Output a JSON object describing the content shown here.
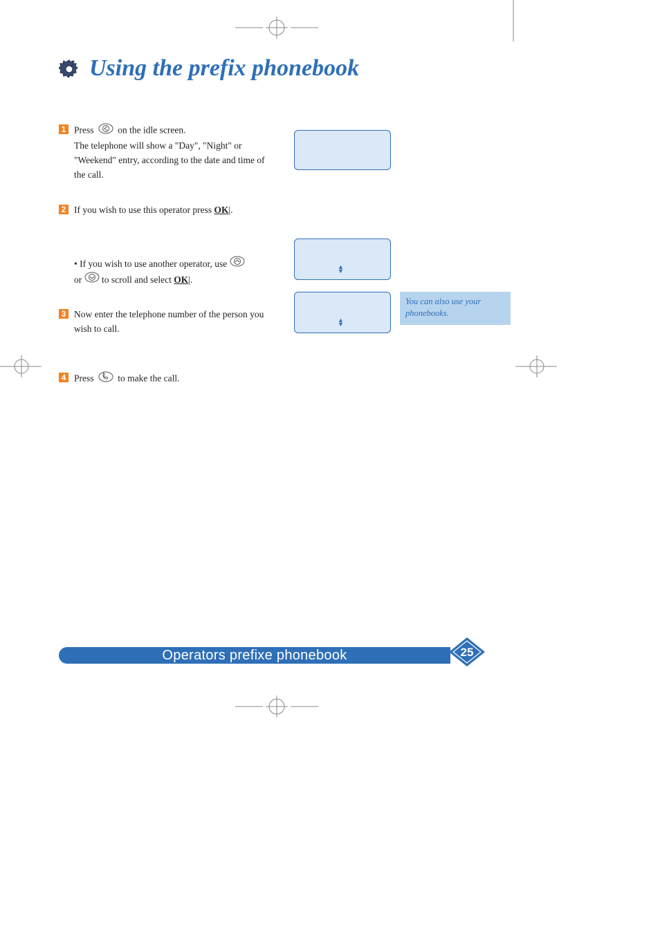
{
  "title": "Using the prefix phonebook",
  "steps": {
    "s1": {
      "num": "1",
      "part_a": "Press",
      "part_b": "on the idle screen.",
      "desc": "The telephone will show a \"Day\", \"Night\" or \"Weekend\" entry, according to the date and time of the call."
    },
    "s2": {
      "num": "2",
      "part_a": "If you wish to use this operator press",
      "ok": "OK",
      "part_b": "|."
    },
    "bullet": {
      "part_a": "• If you wish to use another operator, use",
      "part_b": "or",
      "part_c": "to scroll and select",
      "ok": "OK",
      "part_d": "|."
    },
    "s3": {
      "num": "3",
      "text": "Now enter the telephone number of the person you wish to call."
    },
    "s4": {
      "num": "4",
      "part_a": "Press",
      "part_b": "to make the call."
    }
  },
  "note": "You can also use your phonebooks.",
  "footer": {
    "label": "Operators prefixe phonebook",
    "page": "25"
  }
}
